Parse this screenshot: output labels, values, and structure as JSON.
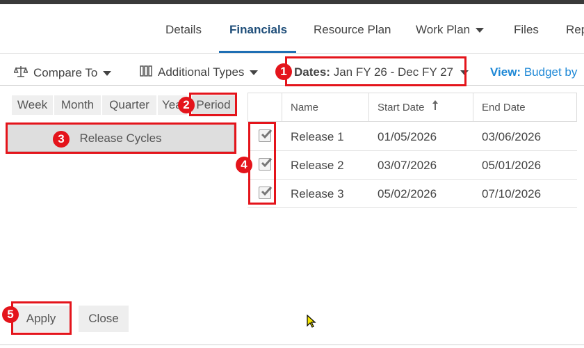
{
  "tabs": [
    {
      "label": "Details"
    },
    {
      "label": "Financials",
      "active": true
    },
    {
      "label": "Resource Plan"
    },
    {
      "label": "Work Plan"
    },
    {
      "label": "Files"
    },
    {
      "label": "Rep"
    }
  ],
  "toolbar": {
    "compare_to": "Compare To",
    "additional_types": "Additional Types",
    "dates_label": "Dates:",
    "dates_value": "Jan FY 26 - Dec FY 27",
    "view_label": "View:",
    "view_value": "Budget by"
  },
  "period_tabs": [
    "Week",
    "Month",
    "Quarter",
    "Yea",
    "Period"
  ],
  "release_cycles": "Release Cycles",
  "table": {
    "headers": {
      "name": "Name",
      "start": "Start Date",
      "end": "End Date"
    },
    "rows": [
      {
        "name": "Release 1",
        "start": "01/05/2026",
        "end": "03/06/2026",
        "checked": true
      },
      {
        "name": "Release 2",
        "start": "03/07/2026",
        "end": "05/01/2026",
        "checked": true
      },
      {
        "name": "Release 3",
        "start": "05/02/2026",
        "end": "07/10/2026",
        "checked": true
      }
    ]
  },
  "buttons": {
    "apply": "Apply",
    "close": "Close"
  },
  "callouts": [
    "1",
    "2",
    "3",
    "4",
    "5"
  ],
  "colors": {
    "accent": "#1f6fb4",
    "callout": "#e4141b",
    "view": "#1e88d6"
  }
}
